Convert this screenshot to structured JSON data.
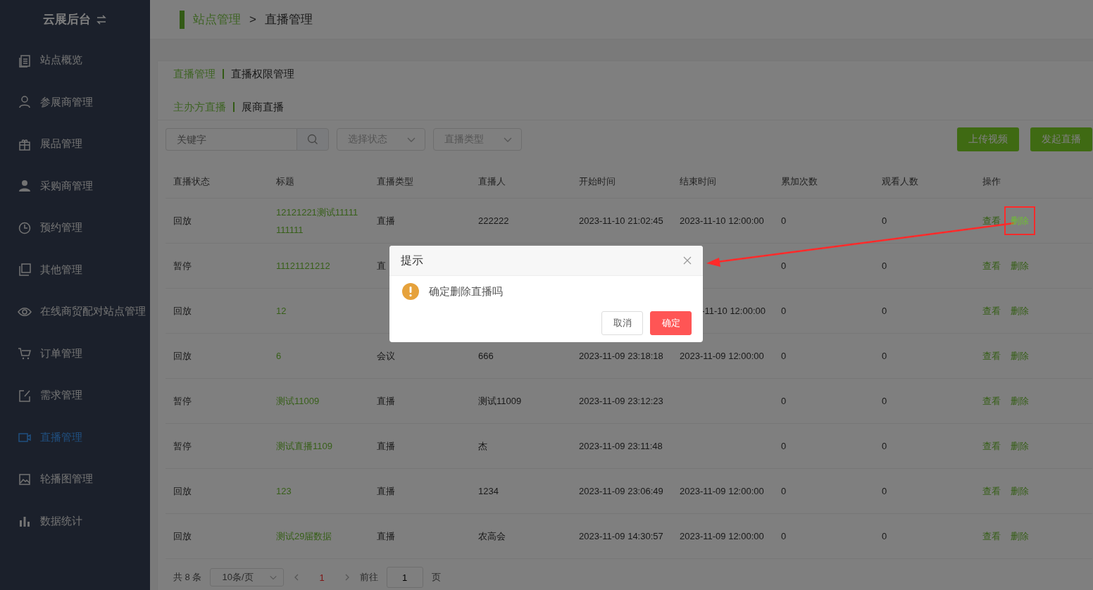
{
  "sidebar": {
    "title": "云展后台",
    "items": [
      {
        "label": "站点概览",
        "selected": false
      },
      {
        "label": "参展商管理",
        "selected": false
      },
      {
        "label": "展品管理",
        "selected": false
      },
      {
        "label": "采购商管理",
        "selected": false
      },
      {
        "label": "预约管理",
        "selected": false
      },
      {
        "label": "其他管理",
        "selected": false
      },
      {
        "label": "在线商贸配对站点管理",
        "selected": false
      },
      {
        "label": "订单管理",
        "selected": false
      },
      {
        "label": "需求管理",
        "selected": false
      },
      {
        "label": "直播管理",
        "selected": true
      },
      {
        "label": "轮播图管理",
        "selected": false
      },
      {
        "label": "数据统计",
        "selected": false
      }
    ]
  },
  "breadcrumb": {
    "items": [
      {
        "label": "站点管理",
        "kind": "link"
      },
      {
        "label": "直播管理",
        "kind": "current"
      }
    ],
    "separator": ">"
  },
  "main_tabs": [
    {
      "label": "直播管理",
      "selected": true
    },
    {
      "label": "直播权限管理",
      "selected": false
    }
  ],
  "sub_tabs": [
    {
      "label": "主办方直播",
      "selected": true
    },
    {
      "label": "展商直播",
      "selected": false
    }
  ],
  "filters": {
    "keyword_placeholder": "关键字",
    "status_placeholder": "选择状态",
    "type_placeholder": "直播类型"
  },
  "buttons": [
    "上传视频",
    "发起直播"
  ],
  "table": {
    "columns": [
      "直播状态",
      "标题",
      "直播类型",
      "直播人",
      "开始时间",
      "结束时间",
      "累加次数",
      "观看人数",
      "操作"
    ],
    "rows": [
      {
        "status": "回放",
        "title": "12121221测试11111111111",
        "type": "直播",
        "presenter": "222222",
        "start": "2023-11-10 21:02:45",
        "end": "2023-11-10 12:00:00",
        "count": "0",
        "viewers": "0",
        "actions": [
          "查看",
          "删除"
        ],
        "delete_highlighted": true
      },
      {
        "status": "暂停",
        "title": "11121121212",
        "type": "直",
        "count": "0",
        "viewers": "0",
        "actions": [
          "查看",
          "删除"
        ],
        "delete_highlighted": false
      },
      {
        "status": "回放",
        "title": "12",
        "end": "-11-10 12:00:00",
        "end_cut": true,
        "count": "0",
        "viewers": "0",
        "actions": [
          "查看",
          "删除"
        ],
        "delete_highlighted": false
      },
      {
        "status": "回放",
        "title": "6",
        "type": "会议",
        "presenter": "666",
        "start": "2023-11-09 23:18:18",
        "end": "2023-11-09 12:00:00",
        "count": "0",
        "viewers": "0",
        "actions": [
          "查看",
          "删除"
        ],
        "delete_highlighted": false
      },
      {
        "status": "暂停",
        "title": "测试11009",
        "type": "直播",
        "presenter": "测试11009",
        "start": "2023-11-09 23:12:23",
        "count": "0",
        "viewers": "0",
        "actions": [
          "查看",
          "删除"
        ],
        "delete_highlighted": false
      },
      {
        "status": "暂停",
        "title": "测试直播1109",
        "type": "直播",
        "presenter": "杰",
        "start": "2023-11-09 23:11:48",
        "count": "0",
        "viewers": "0",
        "actions": [
          "查看",
          "删除"
        ],
        "delete_highlighted": false
      },
      {
        "status": "回放",
        "title": "123",
        "type": "直播",
        "presenter": "1234",
        "start": "2023-11-09 23:06:49",
        "end": "2023-11-09 12:00:00",
        "count": "0",
        "viewers": "0",
        "actions": [
          "查看",
          "删除"
        ],
        "delete_highlighted": false
      },
      {
        "status": "回放",
        "title": "测试29届数据",
        "type": "直播",
        "presenter": "农高会",
        "start": "2023-11-09 14:30:57",
        "end": "2023-11-09 12:00:00",
        "count": "0",
        "viewers": "0",
        "actions": [
          "查看",
          "删除"
        ],
        "delete_highlighted": false
      }
    ]
  },
  "pagination": {
    "total": "共 8 条",
    "page_size": "10条/页",
    "pages": [
      {
        "label": "1",
        "selected": true
      }
    ],
    "goto_label": "前往",
    "goto_value": "1",
    "goto_suffix": "页"
  },
  "dialog": {
    "title": "提示",
    "message": "确定删除直播吗",
    "cancel": "取消",
    "confirm": "确定"
  }
}
